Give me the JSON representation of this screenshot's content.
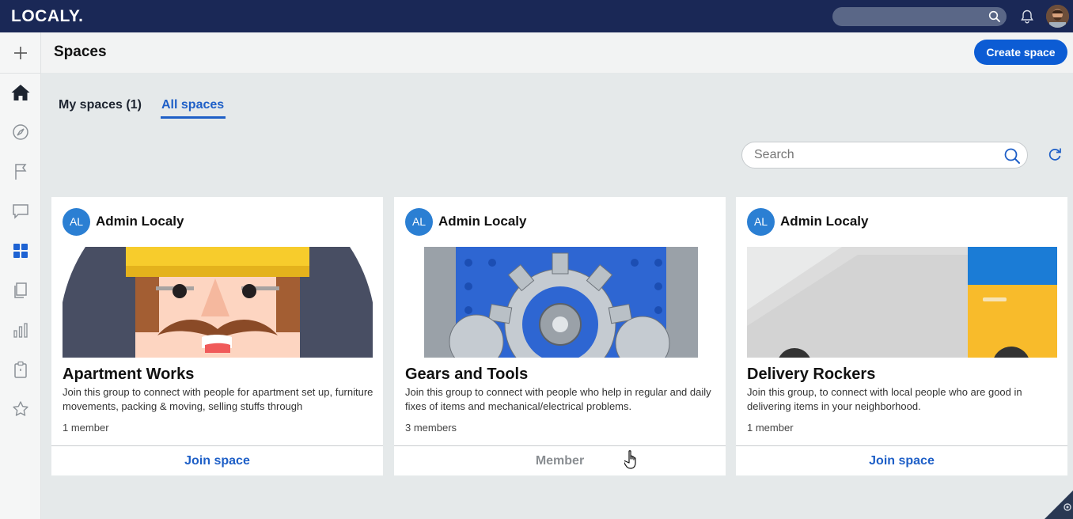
{
  "app": {
    "logo": "LOCALY."
  },
  "topbar": {
    "search_icon": "search-icon",
    "bell_icon": "bell-icon",
    "avatar": "user-avatar"
  },
  "sidebar": {
    "items": [
      {
        "name": "add",
        "icon": "plus-icon"
      },
      {
        "name": "home",
        "icon": "home-icon",
        "active": true
      },
      {
        "name": "explore",
        "icon": "compass-icon"
      },
      {
        "name": "flags",
        "icon": "flag-icon"
      },
      {
        "name": "messages",
        "icon": "chat-icon"
      },
      {
        "name": "spaces",
        "icon": "grid-icon",
        "selected": true
      },
      {
        "name": "documents",
        "icon": "documents-icon"
      },
      {
        "name": "reports",
        "icon": "bar-chart-icon"
      },
      {
        "name": "clipboard",
        "icon": "clipboard-icon"
      },
      {
        "name": "favorites",
        "icon": "star-icon"
      }
    ]
  },
  "header": {
    "title": "Spaces",
    "create_button": "Create space"
  },
  "tabs": [
    {
      "label": "My spaces (1)",
      "active": false
    },
    {
      "label": "All spaces",
      "active": true
    }
  ],
  "search": {
    "placeholder": "Search",
    "value": ""
  },
  "colors": {
    "accent": "#0c5cd4",
    "topbar": "#1a2856",
    "avatar_badge": "#2b7fd3",
    "link": "#1e5fc7"
  },
  "cards": [
    {
      "initials": "AL",
      "author": "Admin Localy",
      "title": "Apartment Works",
      "description": "Join this group to connect with people for apartment set up, furniture movements, packing & moving, selling stuffs through",
      "members": "1 member",
      "action": "Join space",
      "image": "handyman-illustration"
    },
    {
      "initials": "AL",
      "author": "Admin Localy",
      "title": "Gears and Tools",
      "description": "Join this group to connect with people who help in regular and daily fixes of items and mechanical/electrical problems.",
      "members": "3 members",
      "action": "Member",
      "image": "gears-illustration"
    },
    {
      "initials": "AL",
      "author": "Admin Localy",
      "title": "Delivery Rockers",
      "description": "Join this group, to connect with local people who are good in delivering items in your neighborhood.",
      "members": "1 member",
      "action": "Join space",
      "image": "delivery-truck-illustration"
    }
  ]
}
